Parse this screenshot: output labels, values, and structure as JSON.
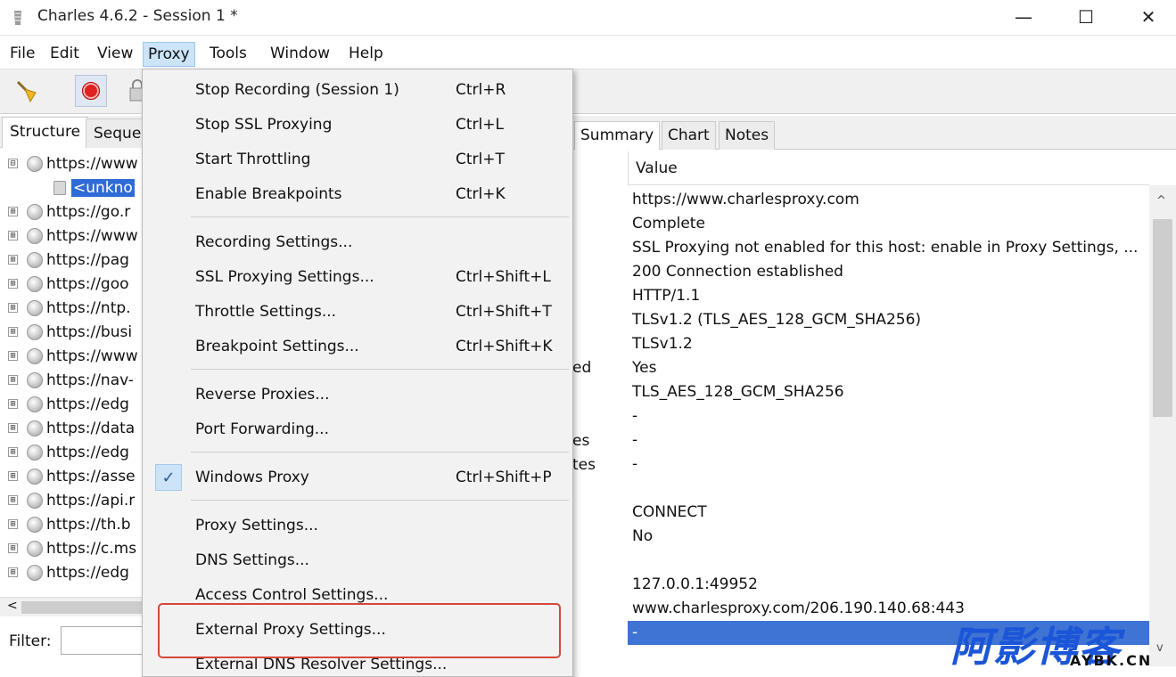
{
  "window": {
    "title": "Charles 4.6.2 - Session 1 *"
  },
  "window_controls": {
    "minimize": "—",
    "maximize": "☐",
    "close": "✕"
  },
  "menubar": [
    "File",
    "Edit",
    "View",
    "Proxy",
    "Tools",
    "Window",
    "Help"
  ],
  "left_tabs": [
    "Structure",
    "Seque"
  ],
  "tree": [
    {
      "expander": "⊟",
      "text": "https://www"
    },
    {
      "expander": "",
      "text": "<unkno"
    },
    {
      "expander": "⊞",
      "text": "https://go.r"
    },
    {
      "expander": "⊞",
      "text": "https://www"
    },
    {
      "expander": "⊞",
      "text": "https://pag"
    },
    {
      "expander": "⊞",
      "text": "https://goo"
    },
    {
      "expander": "⊞",
      "text": "https://ntp."
    },
    {
      "expander": "⊞",
      "text": "https://busi"
    },
    {
      "expander": "⊞",
      "text": "https://www"
    },
    {
      "expander": "⊞",
      "text": "https://nav-"
    },
    {
      "expander": "⊞",
      "text": "https://edg"
    },
    {
      "expander": "⊞",
      "text": "https://data"
    },
    {
      "expander": "⊞",
      "text": "https://edg"
    },
    {
      "expander": "⊞",
      "text": "https://asse"
    },
    {
      "expander": "⊞",
      "text": "https://api.r"
    },
    {
      "expander": "⊞",
      "text": "https://th.b"
    },
    {
      "expander": "⊞",
      "text": "https://c.ms"
    },
    {
      "expander": "⊞",
      "text": "https://edg"
    }
  ],
  "filter": {
    "label": "Filter:"
  },
  "hscroll": {
    "left_arrow": "<"
  },
  "right_tabs": [
    "Summary",
    "Chart",
    "Notes"
  ],
  "table": {
    "value_header": "Value",
    "values": [
      "https://www.charlesproxy.com",
      "Complete",
      "SSL Proxying not enabled for this host: enable in Proxy Settings, ...",
      "200 Connection established",
      "HTTP/1.1",
      "TLSv1.2 (TLS_AES_128_GCM_SHA256)",
      "TLSv1.2",
      "Yes",
      "TLS_AES_128_GCM_SHA256",
      "-",
      "-",
      "-",
      "",
      "CONNECT",
      "No",
      "",
      "127.0.0.1:49952",
      "www.charlesproxy.com/206.190.140.68:443",
      "-"
    ],
    "name_fragments": {
      "row8": "ed",
      "row11": "es",
      "row12": "tes"
    }
  },
  "scroll_arrows": {
    "up": "^",
    "down": "v"
  },
  "proxy_menu": {
    "group1": [
      {
        "label": "Stop Recording (Session 1)",
        "shortcut": "Ctrl+R"
      },
      {
        "label": "Stop SSL Proxying",
        "shortcut": "Ctrl+L"
      },
      {
        "label": "Start Throttling",
        "shortcut": "Ctrl+T"
      },
      {
        "label": "Enable Breakpoints",
        "shortcut": "Ctrl+K"
      }
    ],
    "group2": [
      {
        "label": "Recording Settings...",
        "shortcut": ""
      },
      {
        "label": "SSL Proxying Settings...",
        "shortcut": "Ctrl+Shift+L"
      },
      {
        "label": "Throttle Settings...",
        "shortcut": "Ctrl+Shift+T"
      },
      {
        "label": "Breakpoint Settings...",
        "shortcut": "Ctrl+Shift+K"
      }
    ],
    "group3": [
      {
        "label": "Reverse Proxies...",
        "shortcut": ""
      },
      {
        "label": "Port Forwarding...",
        "shortcut": ""
      }
    ],
    "group4": [
      {
        "label": "Windows Proxy",
        "shortcut": "Ctrl+Shift+P",
        "checked": true,
        "check_glyph": "✓"
      }
    ],
    "group5": [
      {
        "label": "Proxy Settings...",
        "shortcut": ""
      },
      {
        "label": "DNS Settings...",
        "shortcut": ""
      },
      {
        "label": "Access Control Settings...",
        "shortcut": ""
      },
      {
        "label": "External Proxy Settings...",
        "shortcut": ""
      },
      {
        "label": "External DNS Resolver Settings...",
        "shortcut": ""
      }
    ]
  },
  "highlight_color": "#d6473a",
  "selection_color": "#3f73d4",
  "watermark": {
    "big": "阿影博客",
    "small": "AYBK.CN"
  }
}
